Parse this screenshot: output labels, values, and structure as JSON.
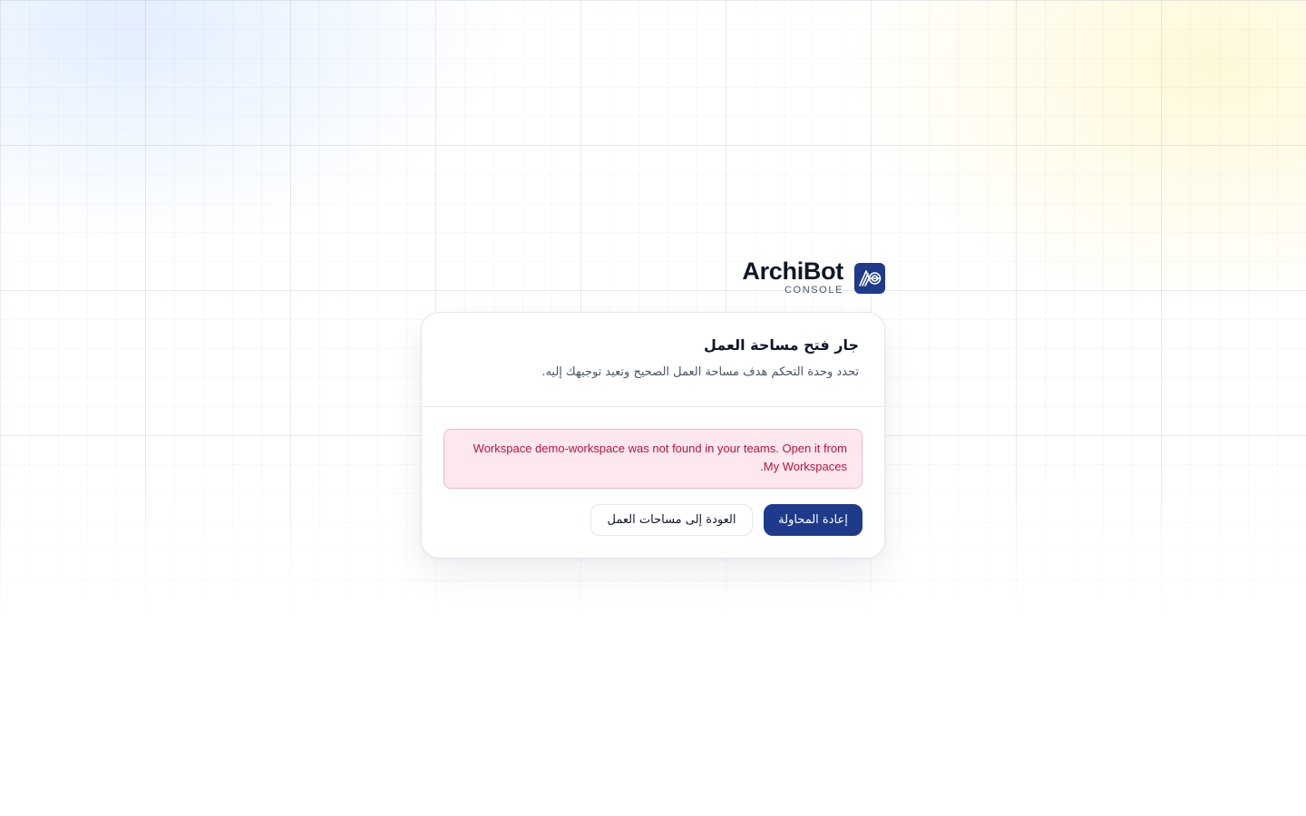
{
  "brand": {
    "name": "ArchiBot",
    "subtitle": "CONSOLE",
    "logo_color": "#1e3a8a"
  },
  "card": {
    "title": "جار فتح مساحة العمل",
    "description": "تحدد وحدة التحكم هدف مساحة العمل الصحيح وتعيد توجيهك إليه.",
    "error_message": "Workspace demo-workspace was not found in your teams. Open it from My Workspaces.",
    "retry_label": "إعادة المحاولة",
    "back_label": "العودة إلى مساحات العمل"
  },
  "colors": {
    "primary": "#1e3a8a",
    "error_text": "#be123c",
    "error_bg": "#fce8ee",
    "error_border": "#f3b6c6"
  }
}
